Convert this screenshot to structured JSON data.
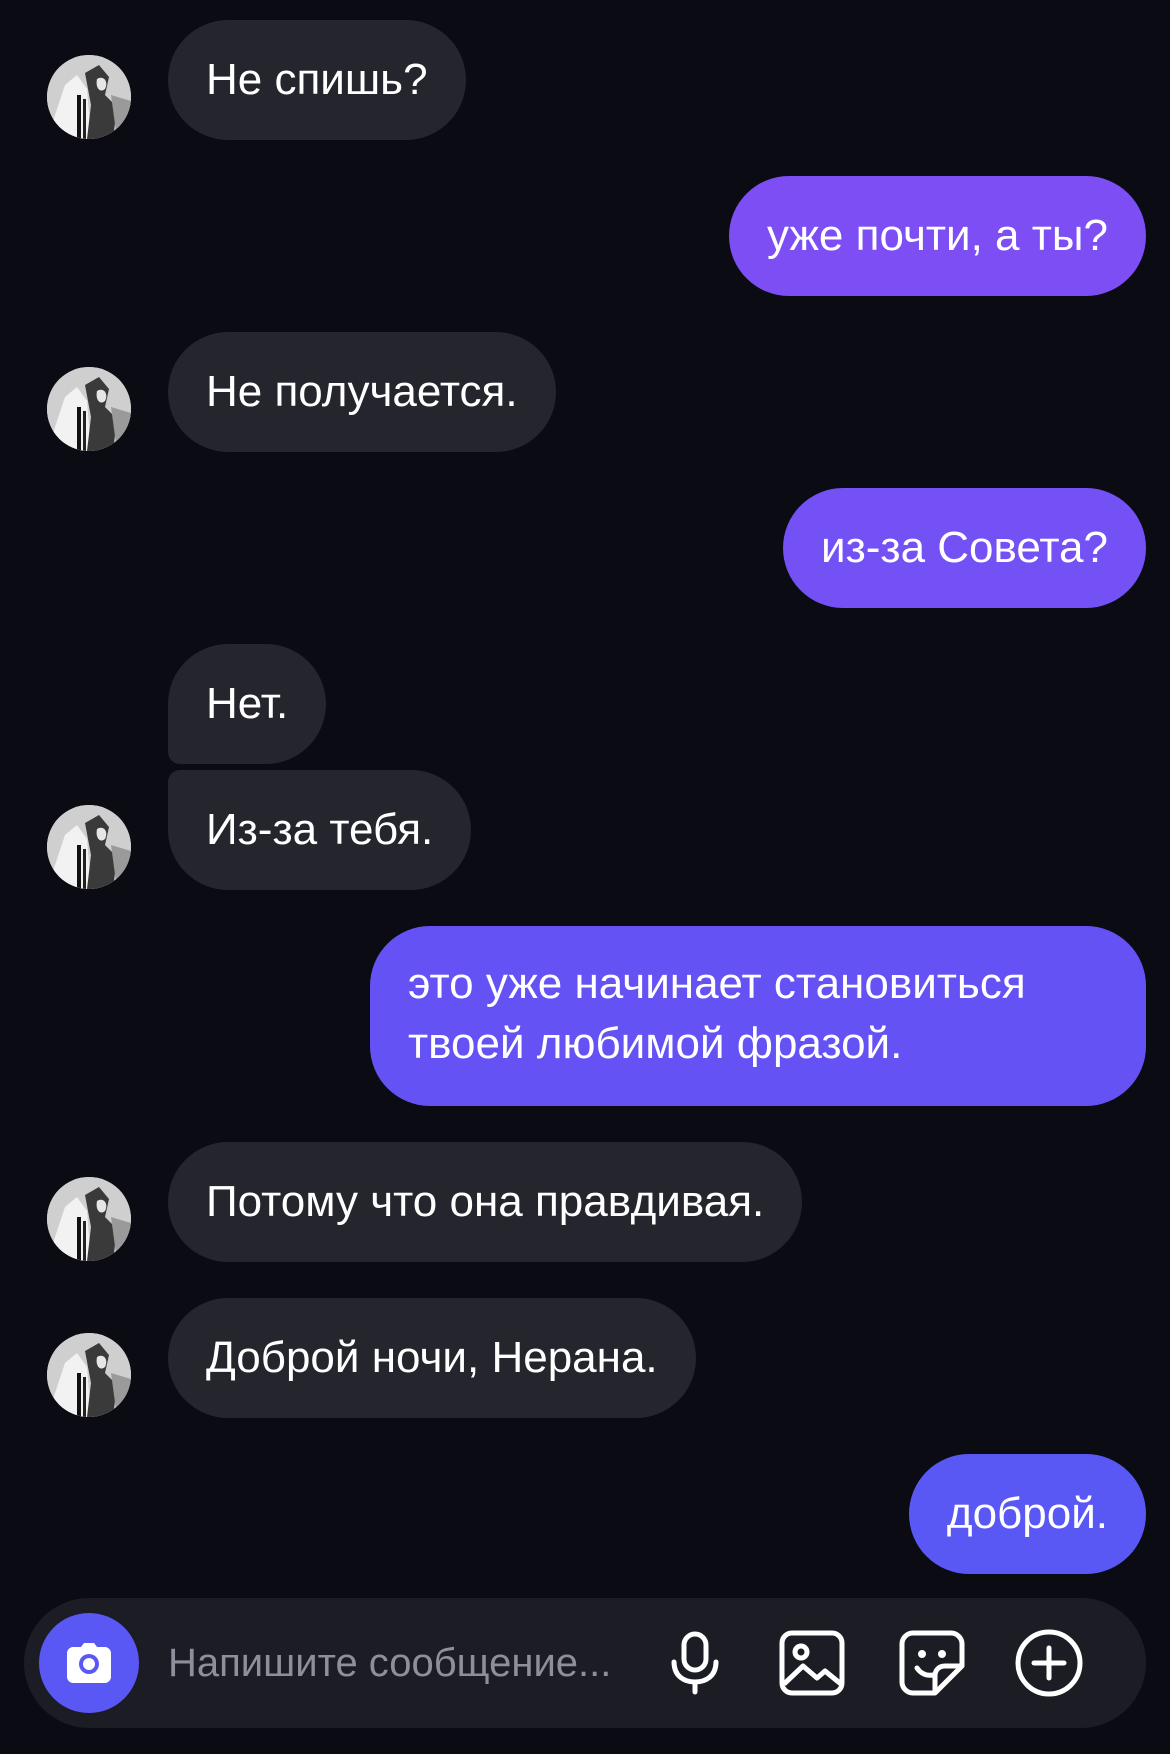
{
  "messages": [
    {
      "from": "them",
      "text": "Не спишь?"
    },
    {
      "from": "me",
      "text": "уже почти, а ты?"
    },
    {
      "from": "them",
      "text": "Не получается."
    },
    {
      "from": "me",
      "text": "из-за Совета?"
    },
    {
      "from": "them",
      "text": "Нет."
    },
    {
      "from": "them",
      "text": "Из-за тебя."
    },
    {
      "from": "me",
      "text": "это уже начинает становиться твоей любимой фразой."
    },
    {
      "from": "them",
      "text": "Потому что она правдивая."
    },
    {
      "from": "them",
      "text": "Доброй ночи, Нерана."
    },
    {
      "from": "me",
      "text": "доброй."
    }
  ],
  "composer": {
    "placeholder": "Напишите сообщение..."
  },
  "icons": {
    "camera": "camera-icon",
    "mic": "microphone-icon",
    "gallery": "image-icon",
    "sticker": "sticker-icon",
    "more": "plus-circle-icon"
  },
  "colors": {
    "background": "#0b0b14",
    "incoming_bubble": "#24252d",
    "outgoing_top": "#8d4cf3",
    "outgoing_bottom": "#5a58f5",
    "accent": "#5a58f5"
  }
}
